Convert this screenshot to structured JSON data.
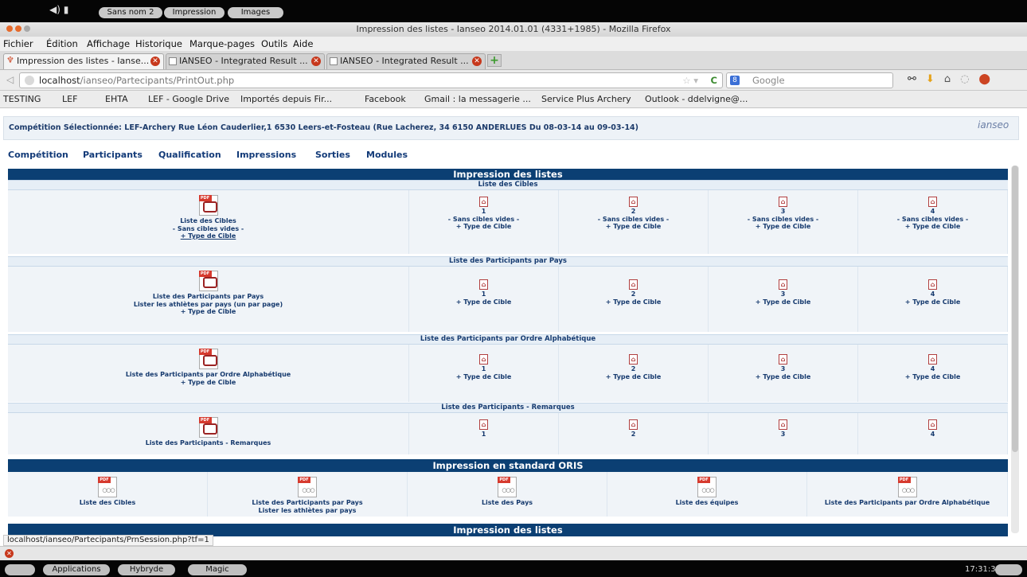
{
  "os_top": {
    "pills": [
      "Sans nom 2",
      "Impression",
      "Images"
    ]
  },
  "window": {
    "title": "Impression des listes - Ianseo 2014.01.01 (4331+1985) - Mozilla Firefox"
  },
  "menubar": [
    "Fichier",
    "Édition",
    "Affichage",
    "Historique",
    "Marque-pages",
    "Outils",
    "Aide"
  ],
  "tabs": [
    {
      "label": "Impression des listes - Ianse..."
    },
    {
      "label": "IANSEO - Integrated Result ..."
    },
    {
      "label": "IANSEO - Integrated Result ..."
    }
  ],
  "navbar": {
    "url_host": "localhost",
    "url_path": "/ianseo/Partecipants/PrintOut.php",
    "search_placeholder": "Google"
  },
  "bookmarks": [
    "TESTING",
    "LEF",
    "EHTA",
    "LEF - Google Drive",
    "Importés depuis Fir...",
    "Facebook",
    "Gmail : la messagerie ...",
    "Service Plus Archery",
    "Outlook - ddelvigne@..."
  ],
  "competition": "Compétition Sélectionnée: LEF-Archery Rue Léon Cauderlier,1 6530 Leers-et-Fosteau (Rue Lacherez, 34 6150 ANDERLUES Du 08-03-14 au 09-03-14)",
  "page_menu": [
    "Compétition",
    "Participants",
    "Qualification",
    "Impressions",
    "Sorties",
    "Modules"
  ],
  "section1": {
    "title": "Impression des listes",
    "s1": {
      "subtitle": "Liste des Cibles",
      "main": [
        "Liste des Cibles",
        "- Sans cibles vides -",
        "+ Type de Cible"
      ],
      "cols": [
        {
          "n": "1",
          "a": "- Sans cibles vides -",
          "b": "+ Type de Cible"
        },
        {
          "n": "2",
          "a": "- Sans cibles vides -",
          "b": "+ Type de Cible"
        },
        {
          "n": "3",
          "a": "- Sans cibles vides -",
          "b": "+ Type de Cible"
        },
        {
          "n": "4",
          "a": "- Sans cibles vides -",
          "b": "+ Type de Cible"
        }
      ]
    },
    "s2": {
      "subtitle": "Liste des Participants par Pays",
      "main": [
        "Liste des Participants par Pays",
        "Lister les athlètes par pays (un par page)",
        "+ Type de Cible"
      ],
      "cols": [
        {
          "n": "1",
          "b": "+ Type de Cible"
        },
        {
          "n": "2",
          "b": "+ Type de Cible"
        },
        {
          "n": "3",
          "b": "+ Type de Cible"
        },
        {
          "n": "4",
          "b": "+ Type de Cible"
        }
      ]
    },
    "s3": {
      "subtitle": "Liste des Participants par Ordre Alphabétique",
      "main": [
        "Liste des Participants par Ordre Alphabétique",
        "+ Type de Cible"
      ],
      "cols": [
        {
          "n": "1",
          "b": "+ Type de Cible"
        },
        {
          "n": "2",
          "b": "+ Type de Cible"
        },
        {
          "n": "3",
          "b": "+ Type de Cible"
        },
        {
          "n": "4",
          "b": "+ Type de Cible"
        }
      ]
    },
    "s4": {
      "subtitle": "Liste des Participants - Remarques",
      "main": [
        "Liste des Participants - Remarques"
      ],
      "cols": [
        {
          "n": "1"
        },
        {
          "n": "2"
        },
        {
          "n": "3"
        },
        {
          "n": "4"
        }
      ]
    }
  },
  "oris": {
    "title": "Impression en standard ORIS",
    "items": [
      {
        "a": "Liste des Cibles"
      },
      {
        "a": "Liste des Participants par Pays",
        "b": "Lister les athlètes par pays"
      },
      {
        "a": "Liste des Pays"
      },
      {
        "a": "Liste des équipes"
      },
      {
        "a": "Liste des Participants par Ordre Alphabétique"
      }
    ]
  },
  "section3": {
    "title": "Impression des listes"
  },
  "status_url": "localhost/ianseo/Partecipants/PrnSession.php?tf=1",
  "taskbar": {
    "items": [
      "Applications",
      "Hybryde",
      "Magic"
    ],
    "clock": "17:31:31"
  }
}
